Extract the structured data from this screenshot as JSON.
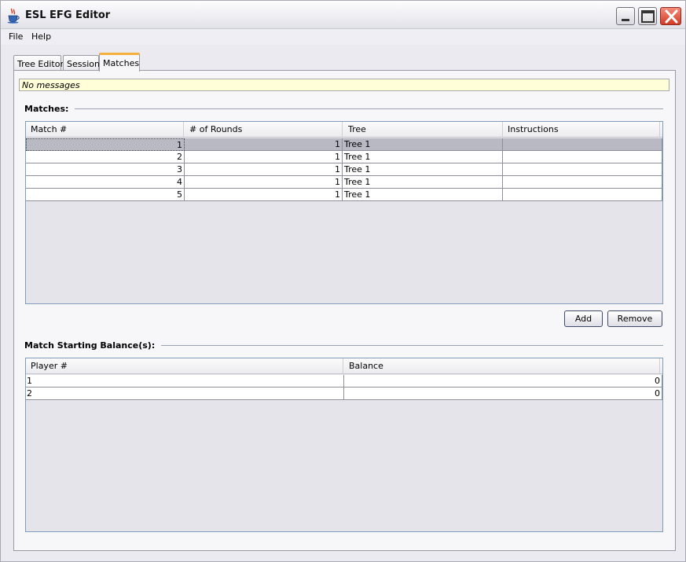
{
  "window": {
    "title": "ESL EFG Editor"
  },
  "menubar": {
    "items": [
      "File",
      "Help"
    ]
  },
  "tabs": [
    "Tree Editor",
    "Session",
    "Matches"
  ],
  "message": "No messages",
  "matches_section": {
    "title": "Matches:",
    "columns": [
      "Match #",
      "# of Rounds",
      "Tree",
      "Instructions"
    ],
    "rows": [
      [
        "1",
        "1",
        "Tree 1",
        ""
      ],
      [
        "2",
        "1",
        "Tree 1",
        ""
      ],
      [
        "3",
        "1",
        "Tree 1",
        ""
      ],
      [
        "4",
        "1",
        "Tree 1",
        ""
      ],
      [
        "5",
        "1",
        "Tree 1",
        ""
      ]
    ],
    "selected_row": 0
  },
  "buttons": {
    "add": "Add",
    "remove": "Remove"
  },
  "balances_section": {
    "title": "Match Starting Balance(s):",
    "columns": [
      "Player #",
      "Balance"
    ],
    "rows": [
      [
        "1",
        "0"
      ],
      [
        "2",
        "0"
      ]
    ]
  },
  "colors": {
    "accent_tab": "#f4b13c",
    "message_bg": "#fffed8",
    "close_button": "#d23c25"
  },
  "icons": [
    "java-cup-icon",
    "minimize-icon",
    "maximize-icon",
    "close-icon"
  ]
}
